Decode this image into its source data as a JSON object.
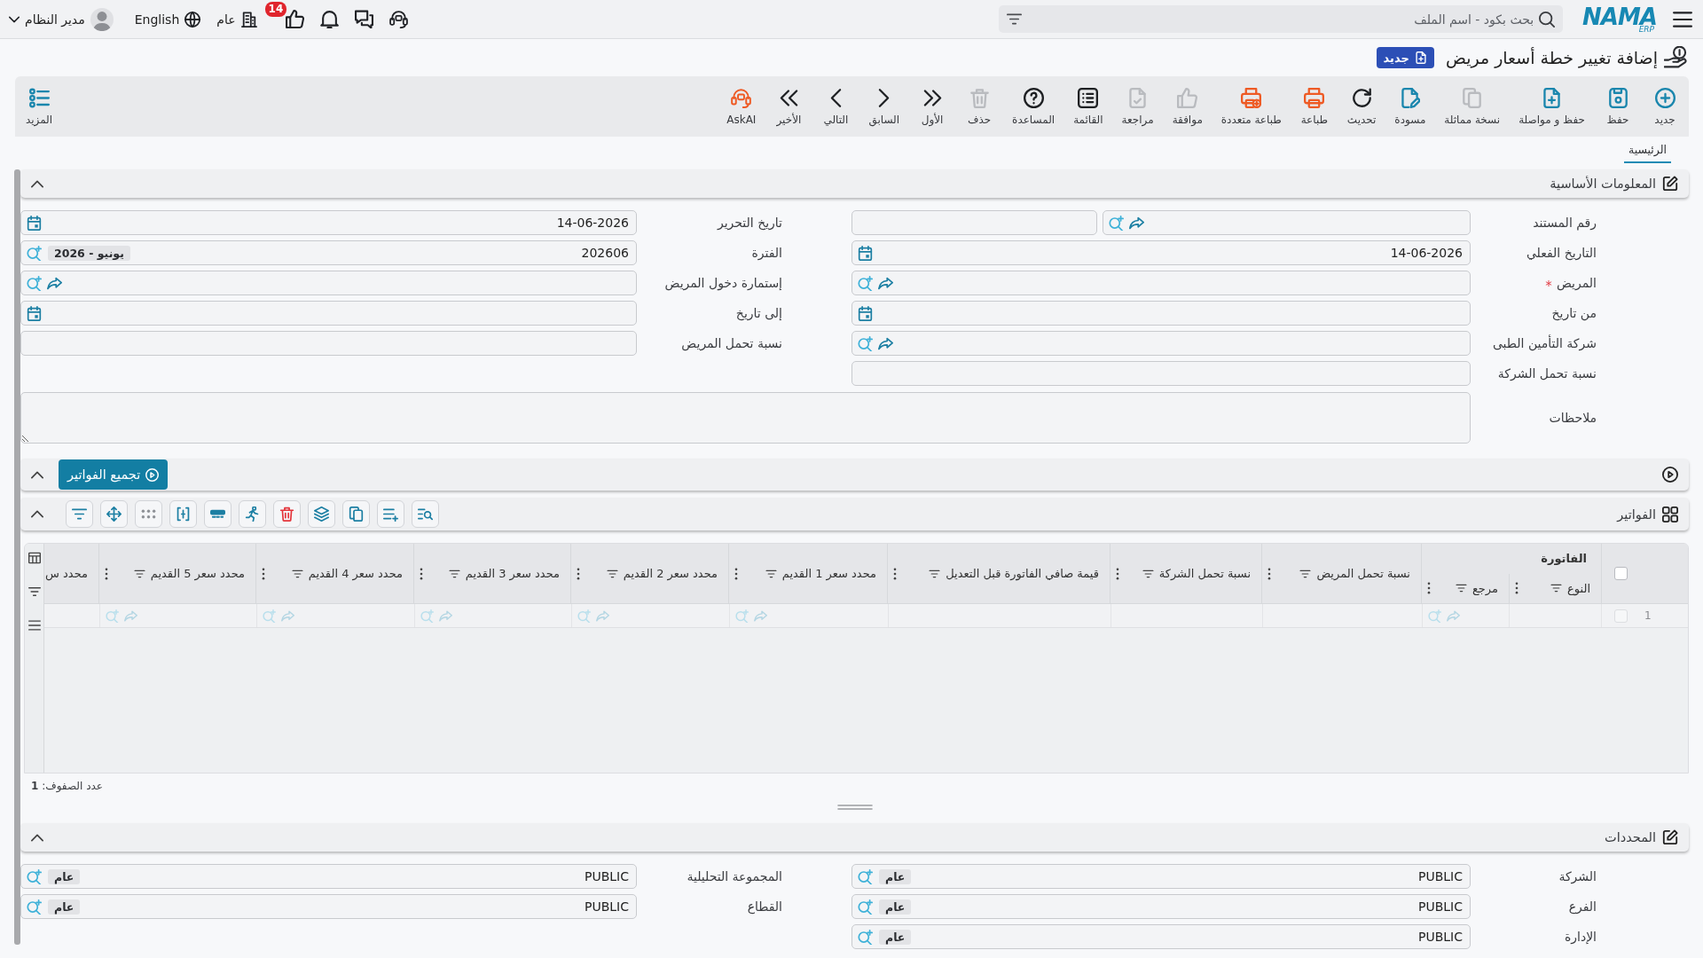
{
  "top_bar": {
    "logo": {
      "wordmark": "NAMA",
      "tagline": "ERP"
    },
    "search": {
      "placeholder": "بحث بكود - اسم الملف"
    },
    "likes_badge": "14",
    "company": "عام",
    "language": "English",
    "user": "مدير النظام"
  },
  "page": {
    "title": "إضافة تغيير خطة أسعار مريض",
    "status": "جديد"
  },
  "toolbar": {
    "buttons": [
      {
        "label": "جديد",
        "disabled": false
      },
      {
        "label": "حفظ",
        "disabled": false
      },
      {
        "label": "حفظ و مواصلة",
        "disabled": false
      },
      {
        "label": "نسخة مماثلة",
        "disabled": true
      },
      {
        "label": "مسودة",
        "disabled": false
      },
      {
        "label": "تحديث",
        "disabled": false
      },
      {
        "label": "طباعة",
        "disabled": false
      },
      {
        "label": "طباعة متعددة",
        "disabled": false
      },
      {
        "label": "موافقة",
        "disabled": true
      },
      {
        "label": "مراجعة",
        "disabled": true
      },
      {
        "label": "القائمة",
        "disabled": false
      },
      {
        "label": "المساعدة",
        "disabled": false
      },
      {
        "label": "حذف",
        "disabled": true
      },
      {
        "label": "الأول",
        "disabled": false
      },
      {
        "label": "السابق",
        "disabled": false
      },
      {
        "label": "التالي",
        "disabled": false
      },
      {
        "label": "الأخير",
        "disabled": false
      },
      {
        "label": "AskAI",
        "disabled": false
      }
    ],
    "more": "المزيد"
  },
  "tabs": [
    {
      "label": "الرئيسية",
      "selected": true
    }
  ],
  "basic_info": {
    "title": "المعلومات الأساسية",
    "expanded": true,
    "right_fields": [
      {
        "label": "رقم المستند",
        "kind": "doc-number",
        "required": false
      },
      {
        "label": "التاريخ الفعلي",
        "kind": "date",
        "required": false,
        "value": "14-06-2026"
      },
      {
        "label": "المريض",
        "kind": "lookup",
        "required": true
      },
      {
        "label": "من تاريخ",
        "kind": "date",
        "required": false
      },
      {
        "label": "شركة التأمين الطبى",
        "kind": "lookup",
        "required": false
      },
      {
        "label": "نسبة تحمل الشركة",
        "kind": "text",
        "required": false
      }
    ],
    "left_fields": [
      {
        "label": "تاريخ التحرير",
        "kind": "date",
        "required": false,
        "value": "14-06-2026"
      },
      {
        "label": "الفترة",
        "kind": "code",
        "required": false,
        "value": "202606",
        "tag": "يونيو - 2026"
      },
      {
        "label": "إستمارة دخول المريض",
        "kind": "lookup",
        "required": false
      },
      {
        "label": "إلى تاريخ",
        "kind": "date",
        "required": false
      },
      {
        "label": "نسبة تحمل المريض",
        "kind": "text",
        "required": false
      }
    ],
    "notes": {
      "label": "ملاحظات"
    }
  },
  "invoice_collection": {
    "expanded": true,
    "action": "تجميع الفواتير"
  },
  "invoices": {
    "title": "الفواتير",
    "expanded": true,
    "select_all": false,
    "columns": [
      {
        "label": "الفاتورة",
        "truncated": false,
        "children": [
          {
            "label": "النوع",
            "kind": "text",
            "truncated": false
          },
          {
            "label": "مرجع",
            "kind": "lookup",
            "truncated": false
          }
        ]
      },
      {
        "label": "نسبة تحمل المريض",
        "kind": "text",
        "truncated": false
      },
      {
        "label": "نسبة تحمل الشركة",
        "kind": "text",
        "truncated": false
      },
      {
        "label": "قيمة صافي الفاتورة قبل التعديل",
        "kind": "text",
        "truncated": false
      },
      {
        "label": "محدد سعر 1 القديم",
        "kind": "lookup",
        "truncated": false
      },
      {
        "label": "محدد سعر 2 القديم",
        "kind": "lookup",
        "truncated": false
      },
      {
        "label": "محدد سعر 3 القديم",
        "kind": "lookup",
        "truncated": false
      },
      {
        "label": "محدد سعر 4 القديم",
        "kind": "lookup",
        "truncated": false
      },
      {
        "label": "محدد سعر 5 القديم",
        "kind": "lookup",
        "truncated": false
      },
      {
        "label": "محدد س",
        "kind": "text",
        "truncated": true
      }
    ],
    "rows": [
      {
        "number": "1",
        "selected": false
      }
    ],
    "row_count": "عدد الصفوف: **1**"
  },
  "dimensions": {
    "title": "المحددات",
    "expanded": true,
    "right_fields": [
      {
        "label": "الشركة",
        "kind": "code",
        "required": false,
        "value": "PUBLIC",
        "tag": "عام"
      },
      {
        "label": "الفرع",
        "kind": "code",
        "required": false,
        "value": "PUBLIC",
        "tag": "عام"
      },
      {
        "label": "الإدارة",
        "kind": "code",
        "required": false,
        "value": "PUBLIC",
        "tag": "عام"
      }
    ],
    "left_fields": [
      {
        "label": "المجموعة التحليلية",
        "kind": "code",
        "required": false,
        "value": "PUBLIC",
        "tag": "عام"
      },
      {
        "label": "القطاع",
        "kind": "code",
        "required": false,
        "value": "PUBLIC",
        "tag": "عام"
      }
    ]
  }
}
